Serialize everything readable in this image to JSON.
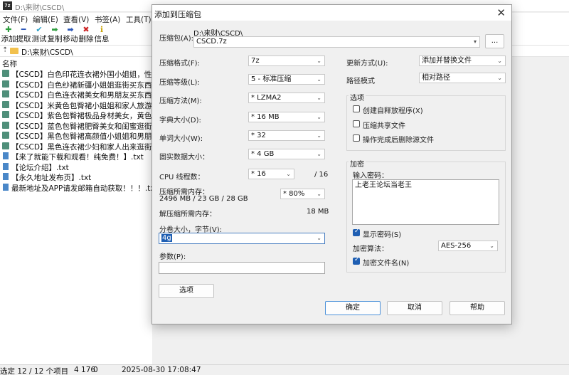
{
  "window": {
    "title": "D:\\来财\\CSCD\\",
    "app_icon": "7z"
  },
  "menu": [
    "文件(F)",
    "编辑(E)",
    "查看(V)",
    "书签(A)",
    "工具(T)"
  ],
  "toolbar": [
    {
      "label": "添加",
      "icon": "add-icon",
      "glyph": "✚",
      "color": "#2e9e3e"
    },
    {
      "label": "提取",
      "icon": "extract-icon",
      "glyph": "━",
      "color": "#2a56b8"
    },
    {
      "label": "测试",
      "icon": "test-icon",
      "glyph": "✔",
      "color": "#2aa0c8"
    },
    {
      "label": "复制",
      "icon": "copy-icon",
      "glyph": "➡",
      "color": "#2e9e3e"
    },
    {
      "label": "移动",
      "icon": "move-icon",
      "glyph": "➡",
      "color": "#2a56b8"
    },
    {
      "label": "删除",
      "icon": "delete-icon",
      "glyph": "✖",
      "color": "#cc2222"
    },
    {
      "label": "信息",
      "icon": "info-icon",
      "glyph": "ℹ",
      "color": "#c8a000"
    }
  ],
  "address": {
    "path": "D:\\来财\\CSCD\\"
  },
  "filelist": {
    "column_header": "名称",
    "rows": [
      {
        "name": "【CSCD】白色印花连衣裙外国小姐姐，性感...",
        "type": "folder"
      },
      {
        "name": "【CSCD】白色纱裙新疆小姐姐逛街买东西，...",
        "type": "folder"
      },
      {
        "name": "【CSCD】白色连衣裙美女和男朋友买东西，...",
        "type": "folder"
      },
      {
        "name": "【CSCD】米黄色包臀裙小姐姐和家人旅游，...",
        "type": "folder"
      },
      {
        "name": "【CSCD】紫色包臀裙极品身材美女，黄色内...",
        "type": "folder"
      },
      {
        "name": "【CSCD】蓝色包臀裙肥臀美女和闺蜜逛街，...",
        "type": "folder"
      },
      {
        "name": "【CSCD】黑色包臀裙高颜值小姐姐和男朋友...",
        "type": "folder"
      },
      {
        "name": "【CSCD】黑色连衣裙少妇和家人出来逛街，...",
        "type": "folder"
      },
      {
        "name": "【来了就能下载和观看！纯免费！】.txt",
        "type": "file"
      },
      {
        "name": "【论坛介绍】.txt",
        "type": "file"
      },
      {
        "name": "【永久地址发布页】.txt",
        "type": "file"
      },
      {
        "name": "最新地址及APP请发邮箱自动获取！！！.txt",
        "type": "file"
      }
    ]
  },
  "status": {
    "selection": "选定 12 / 12 个项目",
    "size": "4 176",
    "zero": "0",
    "datetime": "2025-08-30 17:08:47"
  },
  "dialog": {
    "title": "添加到压缩包",
    "archive_label": "压缩包(A):",
    "archive_dir": "D:\\来财\\CSCD\\",
    "archive_name": "CSCD.7z",
    "browse_label": "...",
    "format_label": "压缩格式(F):",
    "format_value": "7z",
    "level_label": "压缩等级(L):",
    "level_value": "5 - 标准压缩",
    "method_label": "压缩方法(M):",
    "method_value": "* LZMA2",
    "dict_label": "字典大小(D):",
    "dict_value": "* 16 MB",
    "word_label": "单词大小(W):",
    "word_value": "* 32",
    "solid_label": "固实数据大小：",
    "solid_value": "* 4 GB",
    "cpu_label": "CPU 线程数：",
    "cpu_value": "* 16",
    "cpu_total": "/ 16",
    "mem_label": "压缩所需内存：",
    "mem_value": "2496 MB / 23 GB / 28 GB",
    "mem_percent": "* 80%",
    "decomp_label": "解压缩所需内存：",
    "decomp_value": "18 MB",
    "split_label": "分卷大小，字节(V):",
    "split_value": "4g",
    "params_label": "参数(P):",
    "params_value": "",
    "options_button": "选项",
    "update_label": "更新方式(U):",
    "update_value": "添加并替换文件",
    "path_label": "路径模式",
    "path_value": "相对路径",
    "options_group": "选项",
    "opt_sfx": "创建自释放程序(X)",
    "opt_shared": "压缩共享文件",
    "opt_delete": "操作完成后删除源文件",
    "encrypt_group": "加密",
    "password_label": "输入密码：",
    "password_value": "上老王论坛当老王",
    "show_password": "显示密码(S)",
    "enc_method_label": "加密算法：",
    "enc_method_value": "AES-256",
    "enc_names": "加密文件名(N)",
    "ok_button": "确定",
    "cancel_button": "取消",
    "help_button": "帮助"
  }
}
